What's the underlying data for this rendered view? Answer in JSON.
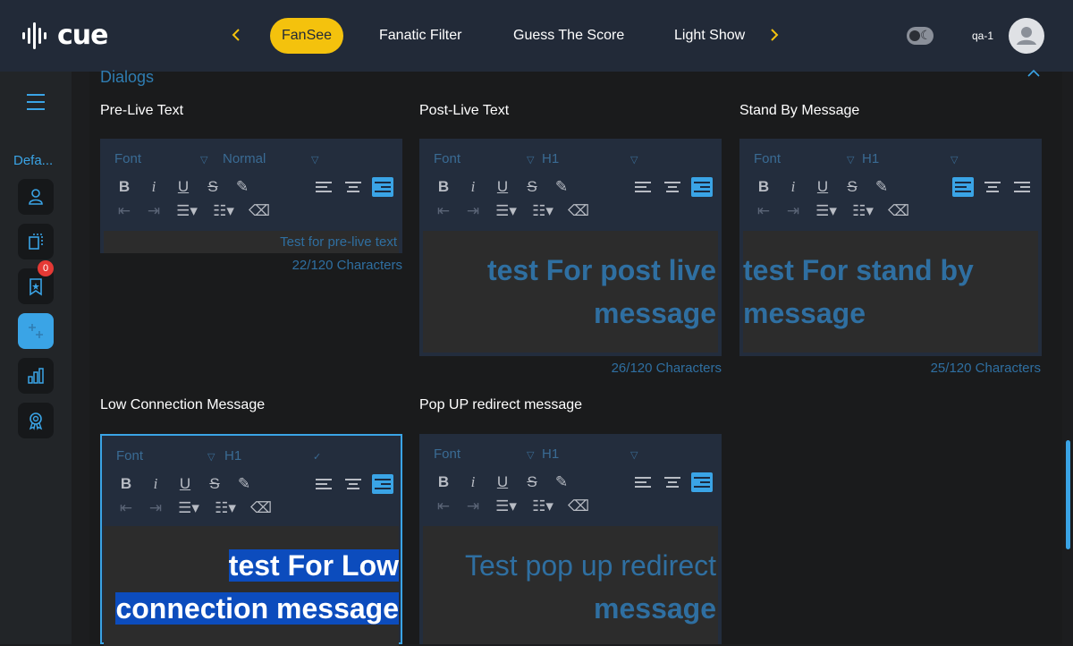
{
  "app": {
    "logo_text": "cue"
  },
  "nav": {
    "tabs": [
      "FanSee",
      "Fanatic Filter",
      "Guess The Score",
      "Light Show"
    ],
    "active_tab": "FanSee"
  },
  "user": {
    "name": "qa-1"
  },
  "sidebar": {
    "label": "Defa...",
    "badge_count": "0"
  },
  "section": {
    "title": "Dialogs"
  },
  "editors": [
    {
      "label": "Pre-Live Text",
      "font": "Font",
      "size": "Normal",
      "text": "Test for pre-live text",
      "counter": "22/120 Characters"
    },
    {
      "label": "Post-Live Text",
      "font": "Font",
      "size": "H1",
      "text": "test For post live message",
      "counter": "26/120 Characters"
    },
    {
      "label": "Stand By Message",
      "font": "Font",
      "size": "H1",
      "text": "test For stand by message",
      "counter": "25/120 Characters"
    },
    {
      "label": "Low Connection Message",
      "font": "Font",
      "size": "H1",
      "text_line1": "test For Low",
      "text_line2": "connection message"
    },
    {
      "label": "Pop UP redirect message",
      "font": "Font",
      "size": "H1",
      "text_line1": "Test pop up redirect",
      "text_line2": "message"
    }
  ],
  "colors": {
    "accent": "#3aa4e6",
    "active_tab": "#f4c20d",
    "topbar": "#222a38",
    "editor_bg": "#232d3d",
    "text_blue": "#2f6fa1",
    "highlight": "#0c4cbd"
  }
}
